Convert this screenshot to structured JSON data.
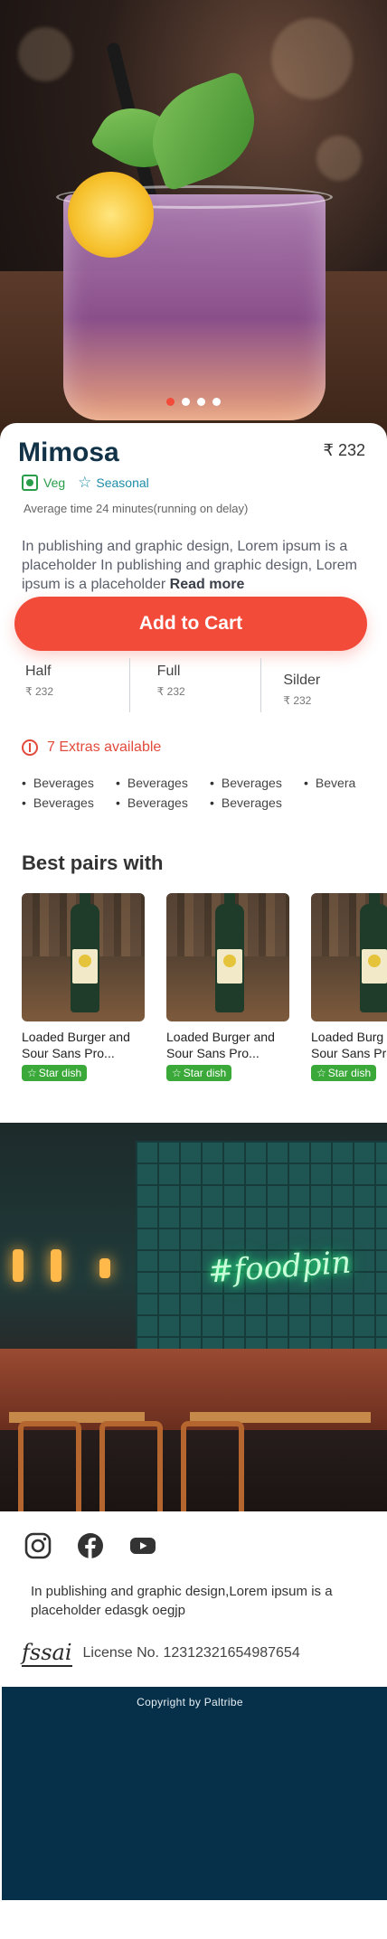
{
  "hero": {
    "carousel_count": 4,
    "carousel_active_index": 0
  },
  "product": {
    "name": "Mimosa",
    "price": "₹ 232",
    "veg_label": "Veg",
    "seasonal_label": "Seasonal",
    "avg_time": "Average time 24 minutes(running on delay)",
    "description": "In publishing and graphic design, Lorem ipsum is a placeholder  In publishing and graphic design, Lorem ipsum is a placeholder",
    "read_more": "Read more",
    "add_to_cart": "Add to Cart"
  },
  "portions": [
    {
      "name": "Half",
      "price": "₹ 232"
    },
    {
      "name": "Full",
      "price": "₹ 232"
    },
    {
      "name": "Silder",
      "price": "₹ 232"
    }
  ],
  "extras": {
    "label": "7 Extras available",
    "items": [
      "Beverages",
      "Beverages",
      "Beverages",
      "Bevera",
      "Beverages",
      "Beverages",
      "Beverages"
    ]
  },
  "best_pairs": {
    "title": "Best pairs with",
    "items": [
      {
        "name_line1": "Loaded Burger and",
        "name_line2": "Sour Sans Pro...",
        "badge": "Star dish"
      },
      {
        "name_line1": "Loaded Burger and",
        "name_line2": "Sour Sans Pro...",
        "badge": "Star dish"
      },
      {
        "name_line1": "Loaded Burg",
        "name_line2": "Sour Sans Pr",
        "badge": "Star dish"
      }
    ]
  },
  "restaurant": {
    "neon_text": "#foodpin"
  },
  "footer": {
    "social_icons": [
      "instagram-icon",
      "facebook-icon",
      "youtube-icon"
    ],
    "text": "In publishing and graphic design,Lorem ipsum is a placeholder edasgk oegjp",
    "fssai_logo": "fssai",
    "license": "License No. 12312321654987654",
    "copyright": "Copyright by Paltribe"
  },
  "colors": {
    "accent": "#f24b3a",
    "veg": "#2a9d4a",
    "seasonal": "#1d8ca8",
    "badge": "#3aa93a",
    "footer_bg": "#063049"
  }
}
